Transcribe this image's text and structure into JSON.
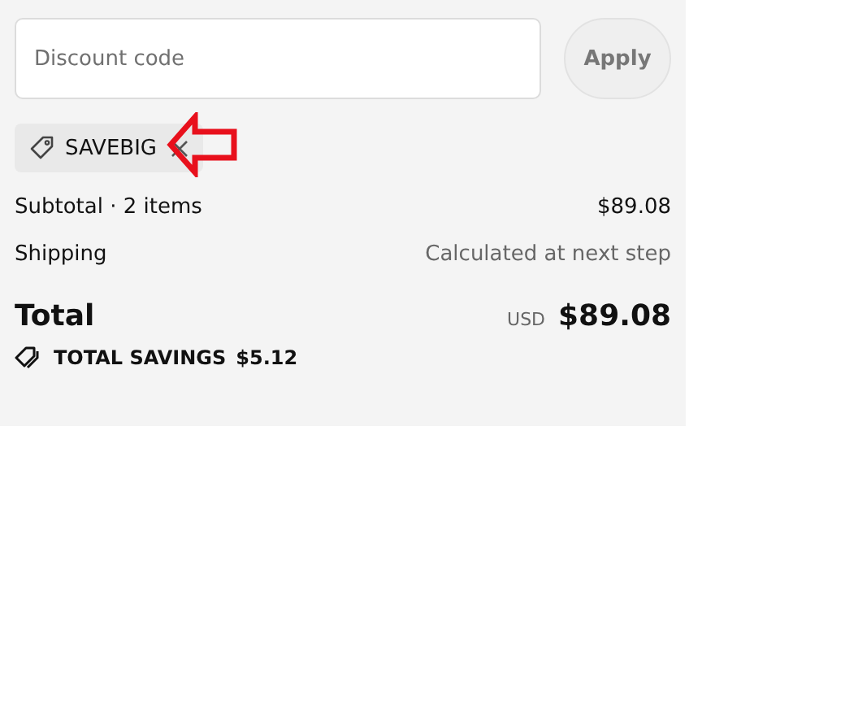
{
  "discount": {
    "placeholder": "Discount code",
    "button": "Apply",
    "applied_code": "SAVEBIG"
  },
  "summary": [
    {
      "label": "Subtotal · 2 items",
      "value": "$89.08",
      "kind": "subtotal"
    },
    {
      "label": "Shipping",
      "value": "Calculated at next step",
      "kind": "note"
    }
  ],
  "total": {
    "label": "Total",
    "currency": "USD",
    "amount": "$89.08"
  },
  "savings": {
    "label": "TOTAL SAVINGS",
    "amount": "$5.12"
  }
}
